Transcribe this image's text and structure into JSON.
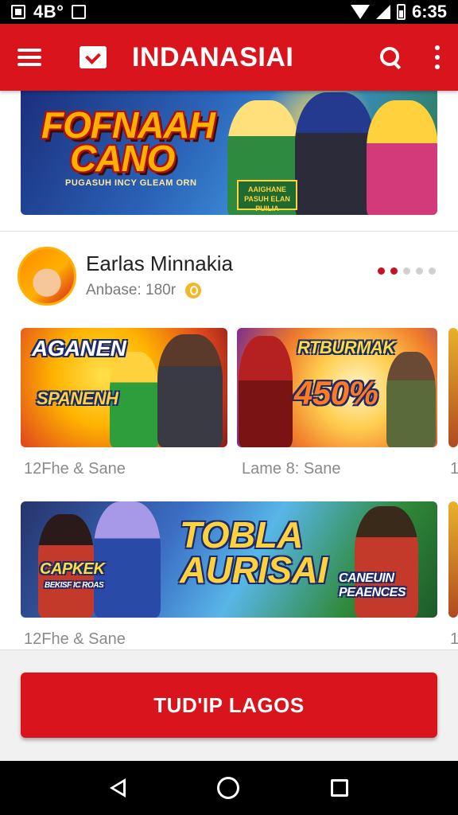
{
  "status_bar": {
    "carrier_text": "4B°",
    "time": "6:35",
    "icons": [
      "notification-icon",
      "download-icon",
      "wifi-icon",
      "signal-icon",
      "battery-icon"
    ]
  },
  "app_bar": {
    "title": "INDANASIAI",
    "color": "#d9141c",
    "icons": [
      "menu-icon",
      "inbox-icon",
      "search-icon",
      "more-icon"
    ]
  },
  "hero_banner": {
    "title_line1": "FOFNAAH",
    "title_line2": "CANO",
    "subtitle": "PUGASUH INCY GLEAM ORN",
    "badge": "AAIGHANE PASUH ELAN PUILIA"
  },
  "profile": {
    "name": "Earlas Minnakia",
    "subtitle": "Anbase: 180r",
    "pager_dots": 5,
    "pager_active": [
      0,
      1
    ]
  },
  "cards_row1": [
    {
      "title": "AGANEN",
      "subtitle": "SPANENH",
      "label": "12Fhe & Sane"
    },
    {
      "title": "RTBURMAK",
      "promo": "450%",
      "label": "Lame 8: Sane"
    },
    {
      "title": "",
      "label": "1"
    }
  ],
  "cards_row2": [
    {
      "title_line1": "TOBLA",
      "title_line2": "AURISAI",
      "left_tag": "CAPKEK",
      "left_tag_sub": "BEKISF IC ROAS",
      "right_tag_line1": "CANEUIN",
      "right_tag_line2": "PEAENCES",
      "label": "12Fhe & Sane"
    },
    {
      "title": "",
      "label": "1"
    }
  ],
  "cta_button": {
    "label": "TUD'IP LAGOS",
    "color": "#d9141c"
  },
  "nav_bar": {
    "icons": [
      "back-icon",
      "home-icon",
      "recents-icon"
    ]
  }
}
